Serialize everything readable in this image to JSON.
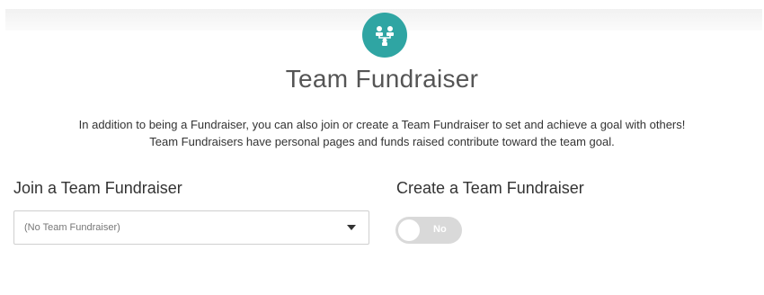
{
  "header": {
    "icon": "team-hierarchy-icon",
    "icon_color": "#2fa5a3",
    "title": "Team Fundraiser"
  },
  "description": {
    "line1": "In addition to being a Fundraiser, you can also join or create a Team Fundraiser to set and achieve a goal with others!",
    "line2": "Team Fundraisers have personal pages and funds raised contribute toward the team goal."
  },
  "join": {
    "heading": "Join a Team Fundraiser",
    "select_value": "(No Team Fundraiser)"
  },
  "create": {
    "heading": "Create a Team Fundraiser",
    "toggle_label": "No",
    "toggle_on": false
  }
}
